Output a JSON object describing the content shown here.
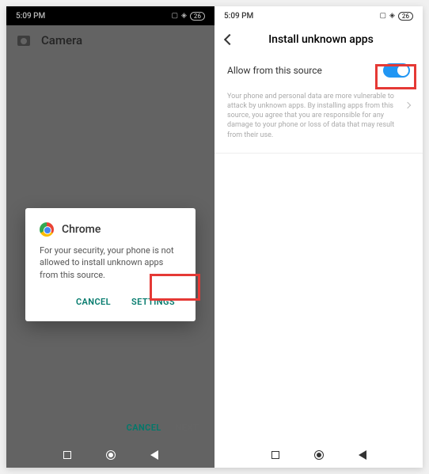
{
  "left": {
    "status": {
      "time": "5:09 PM",
      "battery": "26"
    },
    "header": {
      "title": "Camera"
    },
    "dialog": {
      "title": "Chrome",
      "body": "For your security, your phone is not allowed to install unknown apps from this source.",
      "cancel": "CANCEL",
      "settings": "SETTINGS"
    },
    "bottom": {
      "cancel": "CANCEL",
      "next": "NEXT"
    }
  },
  "right": {
    "status": {
      "time": "5:09 PM",
      "battery": "26"
    },
    "header": {
      "title": "Install unknown apps"
    },
    "setting": {
      "label": "Allow from this source",
      "enabled": true
    },
    "warning": "Your phone and personal data are more vulnerable to attack by unknown apps. By installing apps from this source, you agree that you are responsible for any damage to your phone or loss of data that may result from their use."
  }
}
